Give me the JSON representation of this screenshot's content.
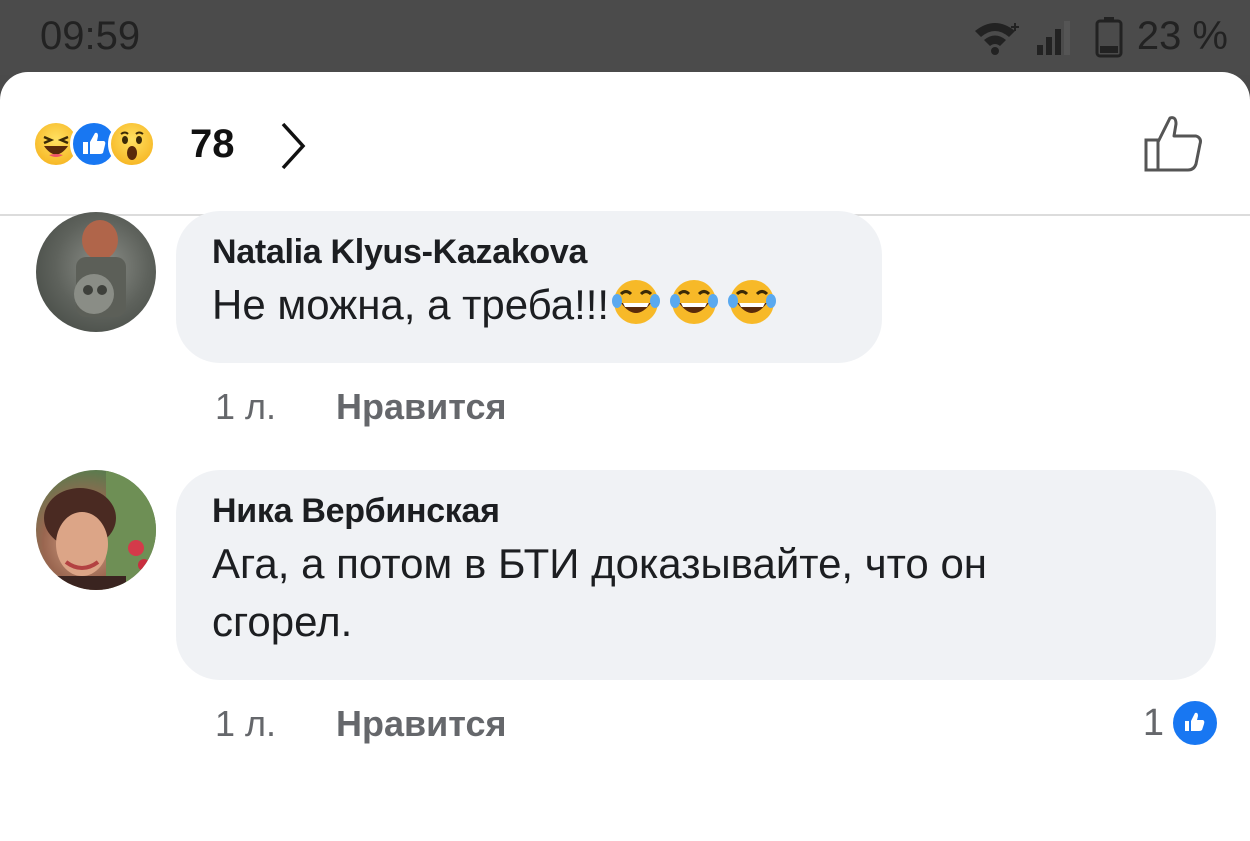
{
  "status_bar": {
    "time": "09:59",
    "battery": "23 %",
    "icons": [
      "wifi-icon",
      "signal-icon",
      "battery-icon"
    ]
  },
  "reactions": {
    "icons": [
      "haha-reaction-icon",
      "like-reaction-icon",
      "wow-reaction-icon"
    ],
    "count": "78"
  },
  "comments": [
    {
      "author": "Natalia Klyus-Kazakova",
      "text": "Не можна, а треба!!!",
      "emoji": [
        "tears-of-joy-icon",
        "tears-of-joy-icon",
        "tears-of-joy-icon"
      ],
      "time": "1 л.",
      "like_label": "Нравится"
    },
    {
      "author": "Ника Вербинская",
      "text_line1": "Ага, а потом в БТИ доказывайте, что он",
      "text_line2": "сгорел.",
      "time": "1 л.",
      "like_label": "Нравится",
      "like_count": "1"
    }
  ],
  "colors": {
    "accent": "#1877f2",
    "bubble": "#f0f2f5",
    "meta_text": "#65676b"
  }
}
